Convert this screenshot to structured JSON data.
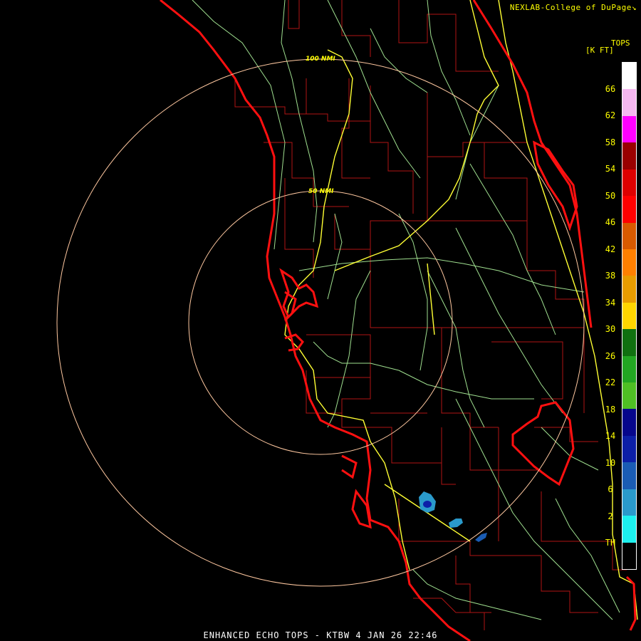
{
  "credit": "NEXLAB-College of DuPage",
  "credit_icon": "arrow-box-icon",
  "legend": {
    "title": "TOPS",
    "units": "[K FT]",
    "labels": [
      "66",
      "62",
      "58",
      "54",
      "50",
      "46",
      "42",
      "38",
      "34",
      "30",
      "26",
      "22",
      "18",
      "14",
      "10",
      "6",
      "2",
      "TH"
    ],
    "colors": [
      "#ffffff",
      "#f5b8f0",
      "#ff00ff",
      "#990000",
      "#dd0000",
      "#ff0000",
      "#d85a00",
      "#ff8000",
      "#e89c00",
      "#ffd500",
      "#107010",
      "#22a622",
      "#4fbf24",
      "#06068c",
      "#0c1fa8",
      "#1a5cb4",
      "#2a9acb",
      "#1df0ee",
      "#000000"
    ]
  },
  "rings": [
    {
      "label": "50 NMI"
    },
    {
      "label": "100 NMI"
    }
  ],
  "footer": "ENHANCED ECHO TOPS - KTBW 4 JAN 26 22:46",
  "colors": {
    "coast": "#ff1010",
    "county": "#b01414",
    "highway": "#ffff33",
    "road": "#a0e090",
    "ring": "#ffc8a0",
    "text": "#ffff00"
  }
}
